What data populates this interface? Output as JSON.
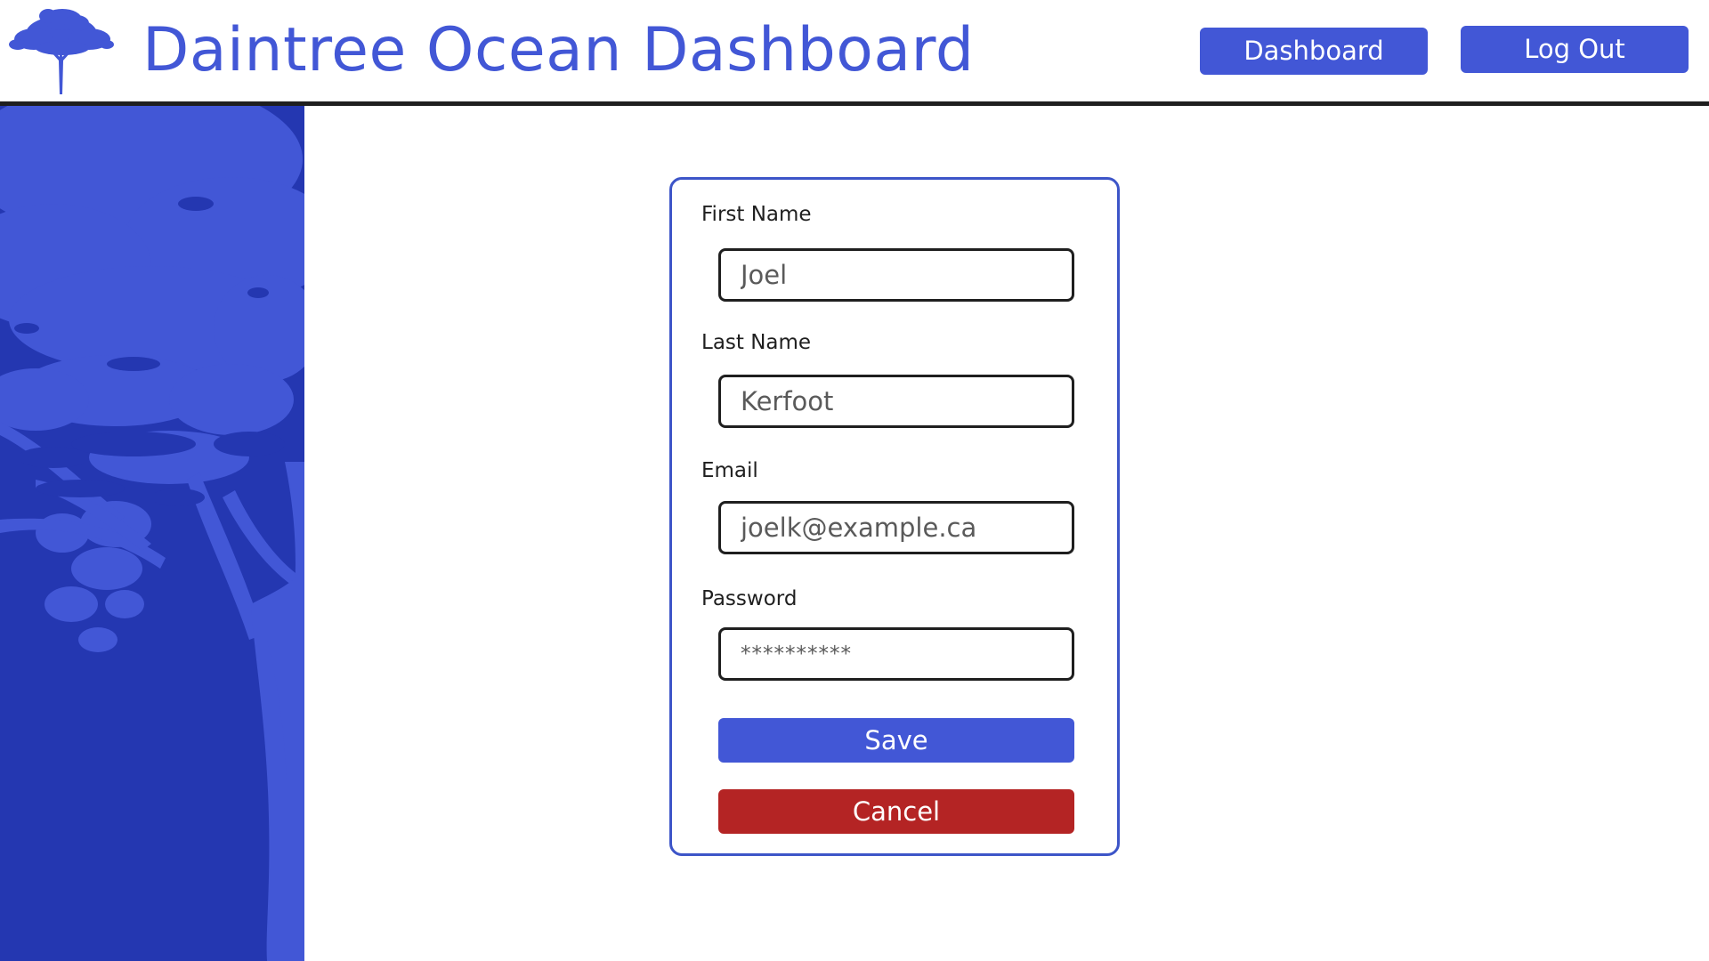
{
  "header": {
    "title": "Daintree Ocean Dashboard",
    "logo_icon": "tree-icon",
    "nav": {
      "dashboard_label": "Dashboard",
      "logout_label": "Log Out"
    }
  },
  "sidebar": {
    "decoration": "tree-silhouette"
  },
  "form": {
    "first_name": {
      "label": "First Name",
      "value": "Joel"
    },
    "last_name": {
      "label": "Last Name",
      "value": "Kerfoot"
    },
    "email": {
      "label": "Email",
      "value": "joelk@example.ca"
    },
    "password": {
      "label": "Password",
      "value": "**********"
    },
    "save_label": "Save",
    "cancel_label": "Cancel"
  },
  "colors": {
    "accent": "#4257d6",
    "sidebar": "#2437b1",
    "sidebar_tree": "#4257d6",
    "danger": "#b42424"
  }
}
